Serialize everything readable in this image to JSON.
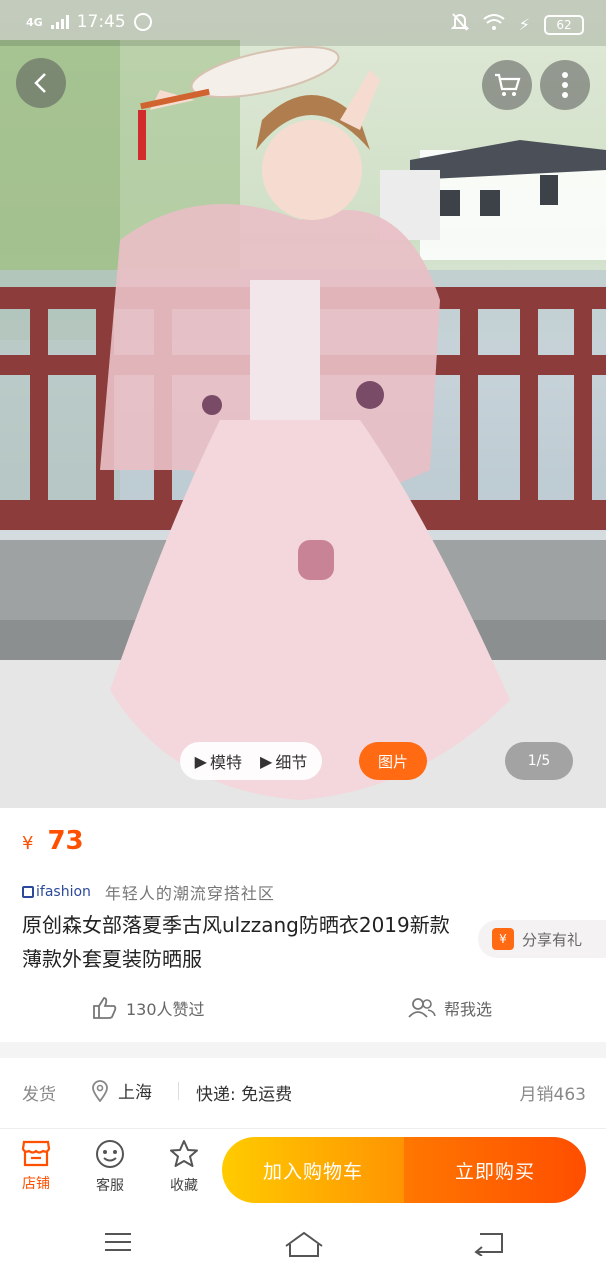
{
  "status_bar": {
    "network": "4G",
    "time": "17:45",
    "battery": "62"
  },
  "gallery": {
    "model_label": "模特",
    "detail_label": "细节",
    "photo_label": "图片",
    "counter": "1/5"
  },
  "product": {
    "currency": "¥",
    "price": "73",
    "brand": "ifashion",
    "slogan": "年轻人的潮流穿搭社区",
    "title": "原创森女部落夏季古风ulzzang防晒衣2019新款薄款外套夏装防晒服",
    "share_label": "分享有礼",
    "share_icon_text": "¥",
    "likes": "130人赞过",
    "help_choose": "帮我选"
  },
  "delivery": {
    "label": "发货",
    "location": "上海",
    "shipping": "快递: 免运费",
    "monthly_sales": "月销463"
  },
  "action_bar": {
    "store": "店铺",
    "service": "客服",
    "favorite": "收藏",
    "add_to_cart": "加入购物车",
    "buy_now": "立即购买"
  },
  "colors": {
    "accent": "#ff5000",
    "cart_yellow": "#ffb300",
    "buy_orange": "#ff6200",
    "brand_blue": "#2c4a9b"
  },
  "icons": [
    "back-icon",
    "cart-icon",
    "more-icon",
    "like-icon",
    "help-choose-icon",
    "location-icon",
    "store-icon",
    "service-icon",
    "star-icon",
    "menu-icon",
    "home-icon",
    "return-icon"
  ]
}
